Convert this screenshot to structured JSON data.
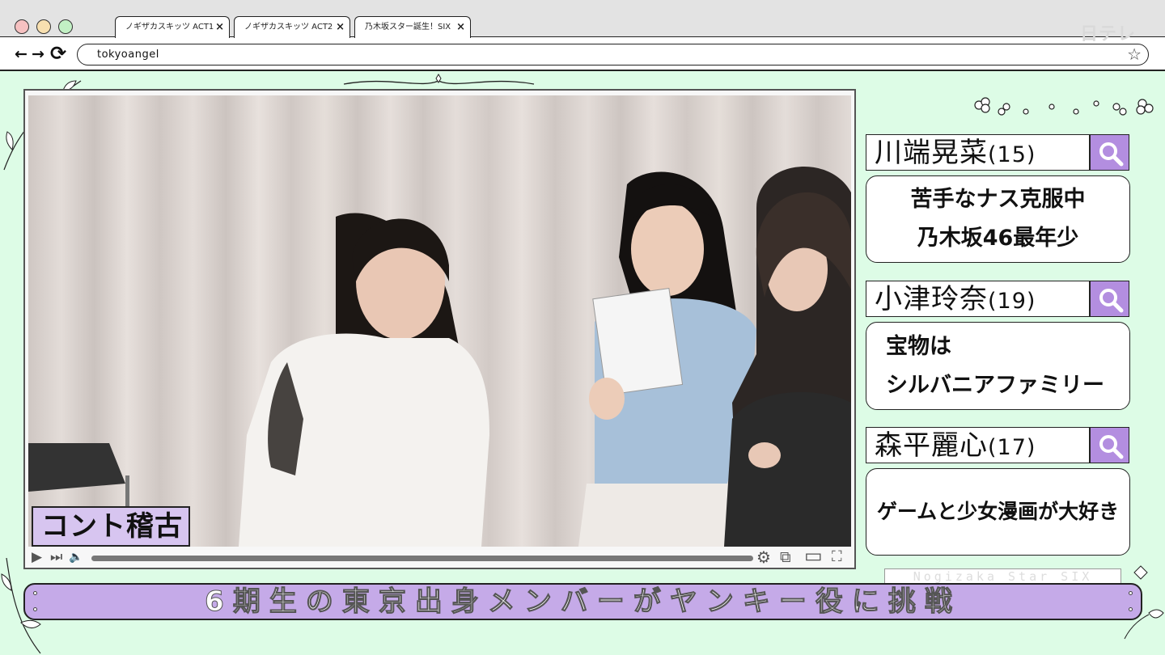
{
  "browser": {
    "tabs": [
      {
        "label": "ノギザカスキッツ ACT1",
        "close": "×"
      },
      {
        "label": "ノギザカスキッツ ACT2",
        "close": "×"
      },
      {
        "label": "乃木坂スター誕生！SIX",
        "close": "×"
      }
    ],
    "address": "tokyoangel",
    "nav": {
      "back": "←",
      "forward": "→",
      "reload": "⟳"
    },
    "star_icon": "☆",
    "network_logo": "日テレ"
  },
  "player": {
    "caption": "コント稽古",
    "controls": {
      "play": "▶",
      "skip": "⏭",
      "volume": "🔈",
      "settings": "⚙",
      "miniplayer": "⧉",
      "theater": "▭",
      "fullscreen": "⛶"
    },
    "progress": 0
  },
  "profiles": [
    {
      "name": "川端晃菜",
      "age": "(15)",
      "lines": [
        "苦手なナス克服中",
        "乃木坂46最年少"
      ]
    },
    {
      "name": "小津玲奈",
      "age": "(19)",
      "lines": [
        "宝物は",
        "シルバニアファミリー"
      ]
    },
    {
      "name": "森平麗心",
      "age": "(17)",
      "lines": [
        "ゲームと少女漫画が大好き"
      ]
    }
  ],
  "show_tag": "Nogizaka Star SIX",
  "headline": "6期生の東京出身メンバーがヤンキー役に挑戦",
  "colors": {
    "background": "#ddfce6",
    "accent_purple": "#b38ee0",
    "banner": "#c5aae8",
    "caption": "#d7c5f0"
  }
}
